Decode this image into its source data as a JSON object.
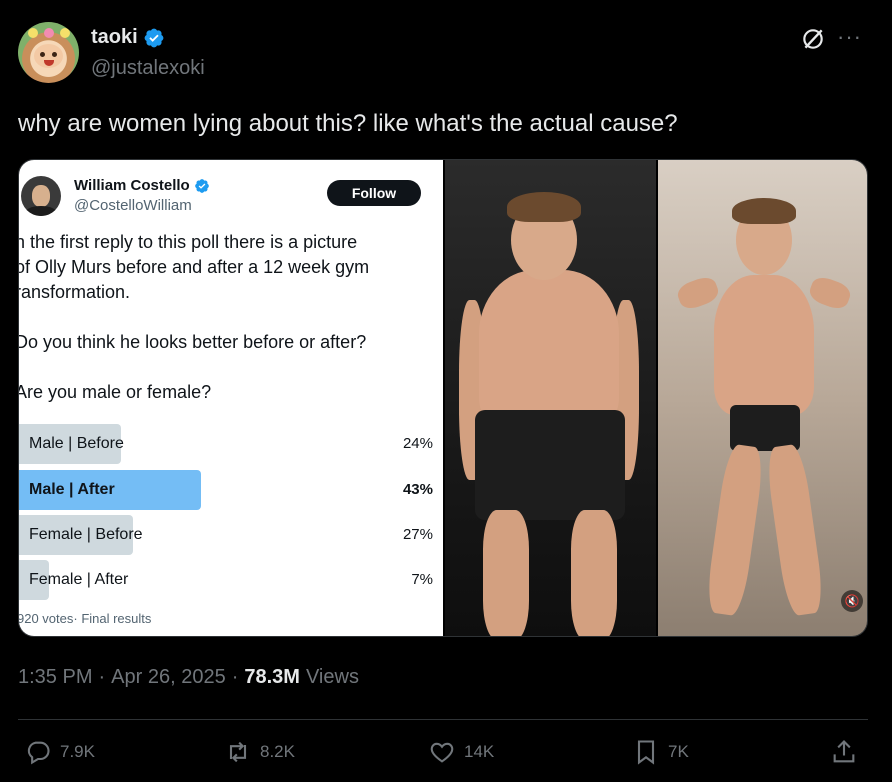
{
  "author": {
    "display_name": "taoki",
    "handle": "@justalexoki"
  },
  "tweet_text": "why are women lying about this? like what's the actual cause?",
  "quoted_card": {
    "display_name": "William Costello",
    "handle": "@CostelloWilliam",
    "follow_label": "Follow",
    "text_lines": [
      "n the first reply to this poll there is a picture",
      "of Olly Murs before and after a 12 week gym",
      "ransformation.",
      "",
      "Do you think he looks better before or after?",
      "",
      "Are you male or female?"
    ],
    "poll": {
      "options": [
        {
          "label": "Male | Before",
          "percent": "24%",
          "fraction": 0.24,
          "winner": false
        },
        {
          "label": "Male | After",
          "percent": "43%",
          "fraction": 0.43,
          "winner": true
        },
        {
          "label": "Female | Before",
          "percent": "27%",
          "fraction": 0.27,
          "winner": false
        },
        {
          "label": "Female | After",
          "percent": "7%",
          "fraction": 0.07,
          "winner": false
        }
      ],
      "footer": "920 votes· Final results"
    }
  },
  "meta": {
    "time": "1:35 PM",
    "separator": "·",
    "date": "Apr 26, 2025",
    "views_count": "78.3M",
    "views_label": "Views"
  },
  "actions": {
    "replies": "7.9K",
    "reposts": "8.2K",
    "likes": "14K",
    "bookmarks": "7K"
  },
  "colors": {
    "background": "#000000",
    "text_primary": "#e7e9ea",
    "text_secondary": "#71767b",
    "verified_blue": "#1d9bf0",
    "poll_winner": "#74bdf5",
    "poll_bar": "#cfd9de"
  },
  "icons": [
    "verified-badge-icon",
    "grok-icon",
    "more-icon",
    "reply-icon",
    "repost-icon",
    "like-icon",
    "bookmark-icon",
    "share-icon",
    "mute-icon"
  ]
}
